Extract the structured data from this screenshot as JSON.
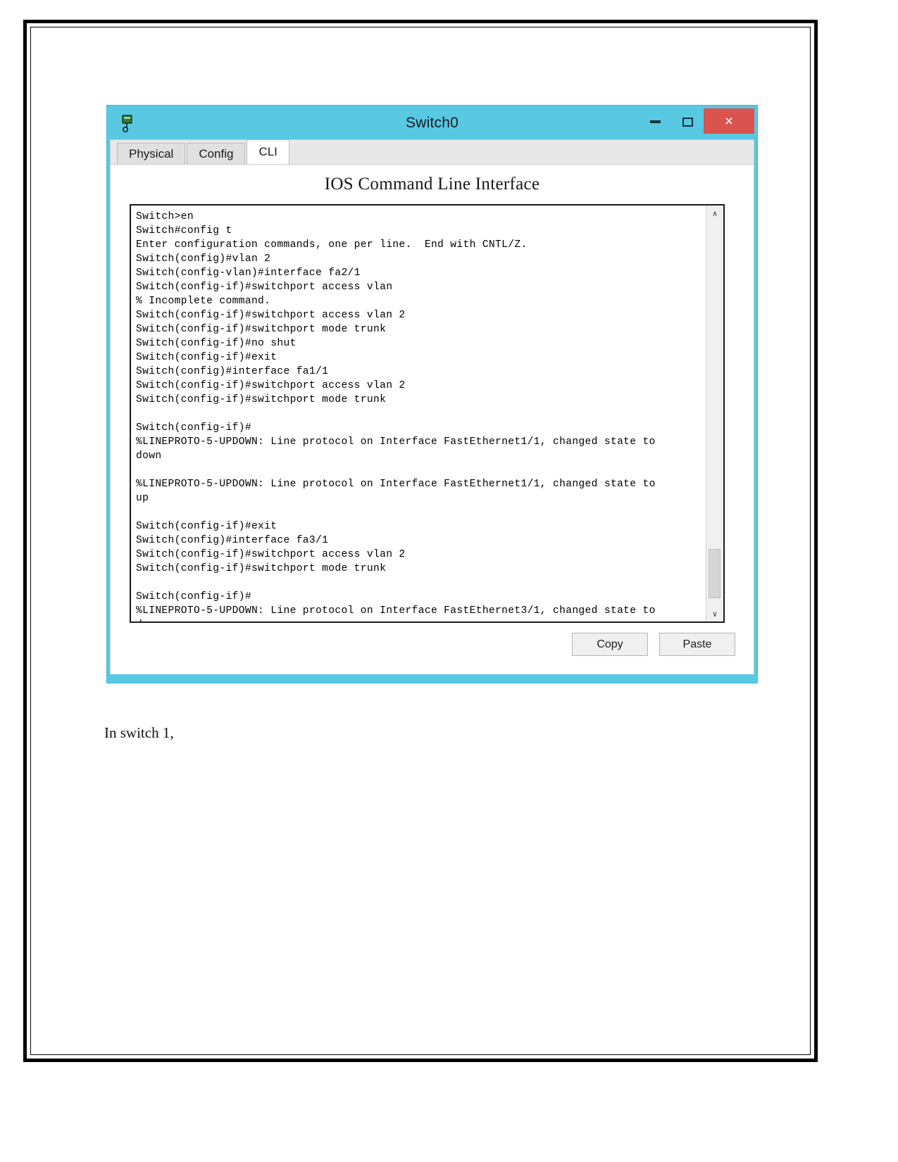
{
  "window": {
    "title": "Switch0",
    "icon": "packet-tracer-switch-icon",
    "controls": {
      "minimize": "–",
      "maximize": "☐",
      "close": "×"
    },
    "close_color": "#d9534f",
    "titlebar_color": "#58c8e3"
  },
  "tabs": [
    {
      "label": "Physical",
      "active": false
    },
    {
      "label": "Config",
      "active": false
    },
    {
      "label": "CLI",
      "active": true
    }
  ],
  "panel": {
    "title": "IOS Command Line Interface"
  },
  "terminal": {
    "lines": [
      "Switch>en",
      "Switch#config t",
      "Enter configuration commands, one per line.  End with CNTL/Z.",
      "Switch(config)#vlan 2",
      "Switch(config-vlan)#interface fa2/1",
      "Switch(config-if)#switchport access vlan",
      "% Incomplete command.",
      "Switch(config-if)#switchport access vlan 2",
      "Switch(config-if)#switchport mode trunk",
      "Switch(config-if)#no shut",
      "Switch(config-if)#exit",
      "Switch(config)#interface fa1/1",
      "Switch(config-if)#switchport access vlan 2",
      "Switch(config-if)#switchport mode trunk",
      "",
      "Switch(config-if)#",
      "%LINEPROTO-5-UPDOWN: Line protocol on Interface FastEthernet1/1, changed state to",
      "down",
      "",
      "%LINEPROTO-5-UPDOWN: Line protocol on Interface FastEthernet1/1, changed state to",
      "up",
      "",
      "Switch(config-if)#exit",
      "Switch(config)#interface fa3/1",
      "Switch(config-if)#switchport access vlan 2",
      "Switch(config-if)#switchport mode trunk",
      "",
      "Switch(config-if)#",
      "%LINEPROTO-5-UPDOWN: Line protocol on Interface FastEthernet3/1, changed state to",
      "down"
    ],
    "scroll_up_glyph": "∧",
    "scroll_down_glyph": "∨"
  },
  "actions": {
    "copy_label": "Copy",
    "paste_label": "Paste"
  },
  "document": {
    "caption": "In switch 1,"
  }
}
